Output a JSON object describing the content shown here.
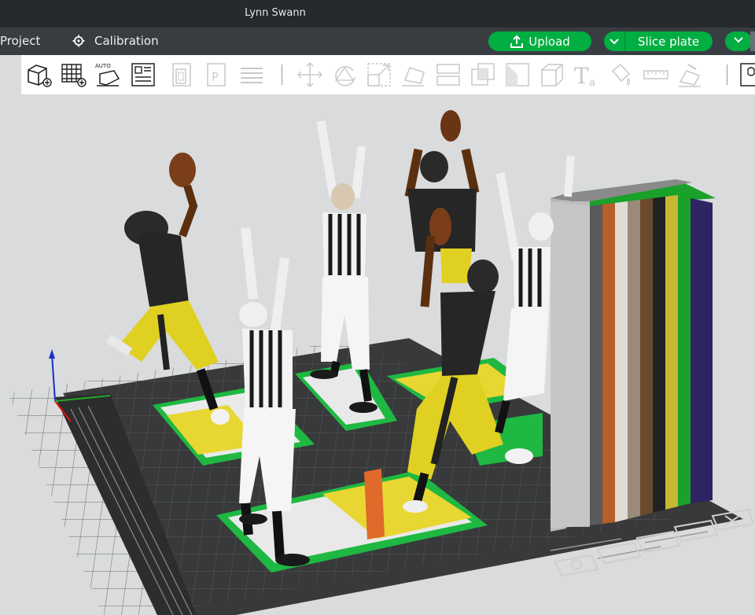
{
  "window": {
    "title": "Lynn Swann"
  },
  "menubar": {
    "project_label": "Project",
    "calibration_label": "Calibration",
    "upload_label": "Upload",
    "slice_label": "Slice plate"
  },
  "toolbar": {
    "icons": [
      "add-object-icon",
      "add-plate-icon",
      "auto-arrange-icon",
      "plate-layout-icon",
      "orient-icon",
      "print-settings-icon",
      "layers-icon",
      "move-icon",
      "rotate-icon",
      "scale-icon",
      "lay-on-face-icon",
      "split-icon",
      "mesh-boolean-icon",
      "cut-icon",
      "measure-cube-icon",
      "text-tool-icon",
      "paint-bucket-icon",
      "ruler-icon",
      "support-paint-icon",
      "assembly-icon"
    ]
  },
  "viewport": {
    "scene": "3D print plate with football player figures, referees and color stack",
    "plate_color": "#3a3b3c",
    "accent": "#00ae42",
    "swatches": [
      "#b8b8b8",
      "#5a5a5a",
      "#b85e2a",
      "#e0dcd5",
      "#9a8a7a",
      "#6a4a2a",
      "#222222",
      "#c9b833",
      "#1aa12a",
      "#2e2464"
    ]
  }
}
